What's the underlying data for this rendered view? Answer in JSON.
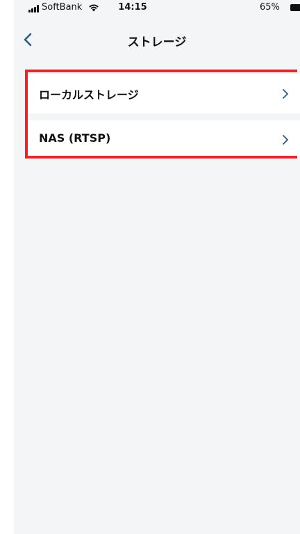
{
  "status_bar": {
    "carrier": "SoftBank",
    "time": "14:15",
    "battery": "65%"
  },
  "nav": {
    "title": "ストレージ",
    "back_icon": "chevron-left-icon"
  },
  "storage_options": [
    {
      "label": "ローカルストレージ",
      "icon": "chevron-right-icon"
    },
    {
      "label": "NAS (RTSP)",
      "icon": "chevron-right-icon"
    }
  ],
  "colors": {
    "accent": "#2b5a8a",
    "highlight": "#e5262a",
    "background": "#f4f5f7"
  }
}
